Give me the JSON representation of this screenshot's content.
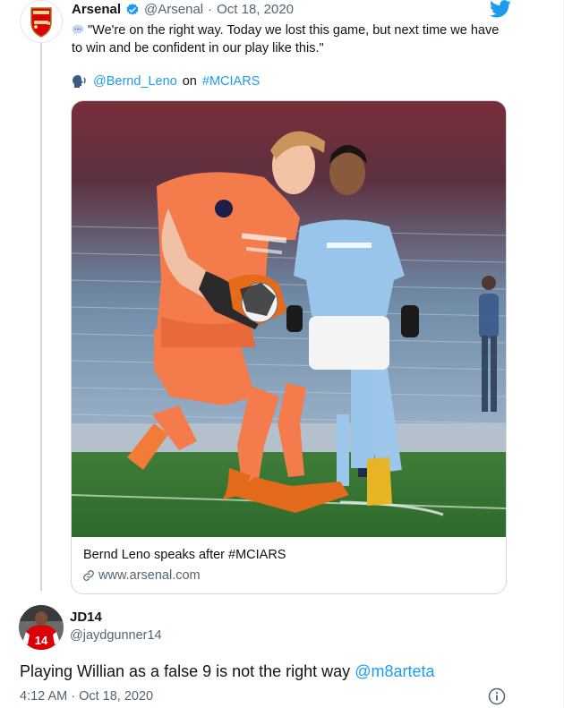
{
  "tweet": {
    "display_name": "Arsenal",
    "handle": "@Arsenal",
    "separator": "·",
    "date": "Oct 18, 2020",
    "text": "\"We're on the right way. Today we lost this game, but next time we have to win and be confident in our play like this.\"",
    "mention_user": "@Bernd_Leno",
    "mention_on": "on",
    "hashtag": "#MCIARS",
    "card": {
      "title": "Bernd Leno speaks after #MCIARS",
      "domain": "www.arsenal.com"
    }
  },
  "reply": {
    "display_name": "JD14",
    "handle": "@jaydgunner14",
    "text": "Playing Willian as a false 9 is not the right way",
    "mention": "@m8arteta",
    "timestamp": "4:12 AM · Oct 18, 2020",
    "jersey_number": "14"
  },
  "icons": [
    "arsenal-crest-icon",
    "verified-icon",
    "twitter-bird-icon",
    "speech-bubble-icon",
    "speaking-head-icon",
    "link-icon",
    "info-icon"
  ],
  "colors": {
    "accent": "#1d9bf0",
    "secondary_text": "#536471",
    "border": "#cfd9de",
    "arsenal_red": "#db0007",
    "keeper_kit": "#f47c4c",
    "city_blue": "#98c5e9"
  }
}
